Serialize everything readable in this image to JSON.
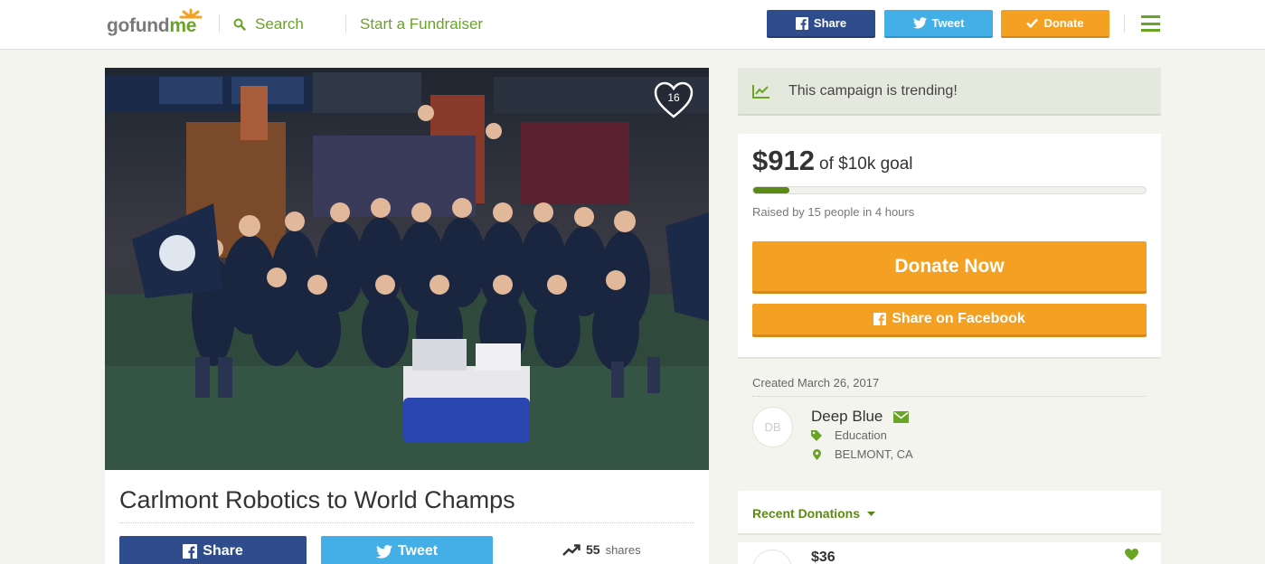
{
  "header": {
    "logo_text_1": "gofund",
    "logo_text_2": "me",
    "search_label": "Search",
    "start_label": "Start a Fundraiser",
    "share_label": "Share",
    "tweet_label": "Tweet",
    "donate_label": "Donate"
  },
  "photo": {
    "heart_count": "16"
  },
  "campaign": {
    "title": "Carlmont Robotics to World Champs",
    "share_label": "Share",
    "tweet_label": "Tweet",
    "shares_count": "55",
    "shares_label": "shares"
  },
  "sidebar": {
    "trending_text": "This campaign is trending!",
    "raised": "$912",
    "goal": "of $10k goal",
    "progress_fraction": 0.0912,
    "raised_by": "Raised by 15 people in 4 hours",
    "donate_now": "Donate Now",
    "share_facebook": "Share on Facebook",
    "created": "Created March 26, 2017",
    "avatar_initials": "DB",
    "organizer_name": "Deep Blue",
    "category": "Education",
    "location": "BELMONT, CA",
    "recent_donations_label": "Recent Donations",
    "first_donation_amount": "$36"
  },
  "colors": {
    "brand_green": "#69a425",
    "facebook_blue": "#2f4d8d",
    "twitter_blue": "#44aee6",
    "donate_orange": "#f3a023"
  },
  "icons": [
    "search-icon",
    "facebook-icon",
    "twitter-icon",
    "check-icon",
    "menu-icon",
    "heart-icon",
    "trending-icon",
    "envelope-icon",
    "tag-icon",
    "map-marker-icon",
    "caret-down-icon"
  ]
}
